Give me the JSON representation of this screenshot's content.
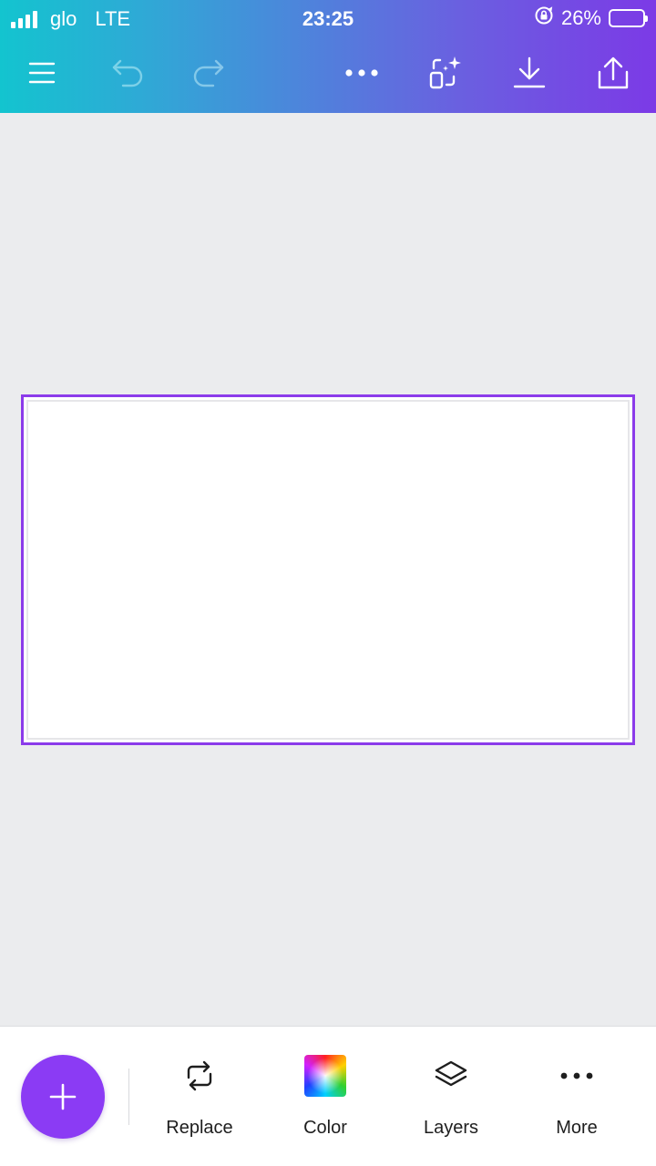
{
  "status_bar": {
    "carrier": "glo",
    "network": "LTE",
    "time": "23:25",
    "battery_percent": "26%",
    "battery_level": 0.26,
    "icons": [
      "signal-bars-icon",
      "orientation-lock-icon",
      "battery-icon"
    ]
  },
  "toolbar": {
    "icons": [
      "menu-icon",
      "undo-icon",
      "redo-icon",
      "more-horizontal-icon",
      "magic-resize-icon",
      "download-icon",
      "share-icon"
    ],
    "gradient": [
      "#13c4cf",
      "#7c3ae6"
    ]
  },
  "canvas": {
    "selection_color": "#8b3bea",
    "page_color": "#ffffff"
  },
  "bottom_bar": {
    "add_icon": "plus-icon",
    "fab_color": "#8b3bf4",
    "tools": [
      {
        "label": "Replace",
        "icon": "replace-icon"
      },
      {
        "label": "Color",
        "icon": "color-swatch-icon"
      },
      {
        "label": "Layers",
        "icon": "layers-icon"
      },
      {
        "label": "More",
        "icon": "more-horizontal-icon"
      }
    ]
  }
}
